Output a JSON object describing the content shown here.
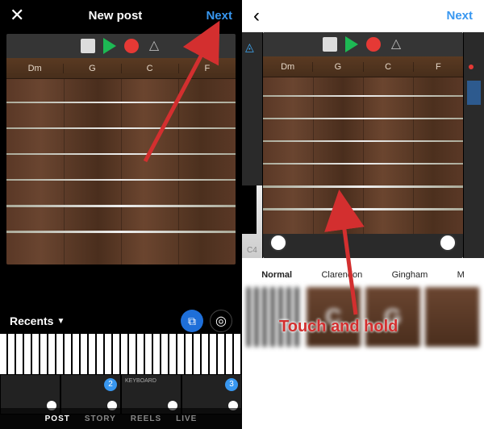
{
  "left": {
    "header": {
      "title": "New post",
      "next": "Next"
    },
    "chords": [
      "Dm",
      "G",
      "C",
      "F"
    ],
    "recents_label": "Recents",
    "tabs": [
      "POST",
      "STORY",
      "REELS",
      "LIVE"
    ],
    "active_tab": "POST",
    "keyboard_label": "KEYBOARD",
    "selection_badges": [
      "2",
      "3"
    ]
  },
  "right": {
    "next": "Next",
    "peek_note": "C4",
    "chords": [
      "Dm",
      "G",
      "C",
      "F"
    ],
    "filters": [
      "Normal",
      "Clarendon",
      "Gingham",
      "M"
    ],
    "thumb_letters": [
      "",
      "C",
      "G",
      ""
    ]
  },
  "annotation": {
    "text": "Touch and hold"
  }
}
